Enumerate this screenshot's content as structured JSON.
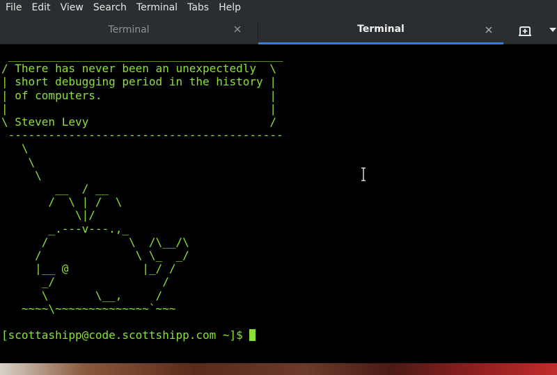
{
  "menu": {
    "items": [
      "File",
      "Edit",
      "View",
      "Search",
      "Terminal",
      "Tabs",
      "Help"
    ]
  },
  "tabs": [
    {
      "label": "Terminal",
      "active": false
    },
    {
      "label": "Terminal",
      "active": true
    }
  ],
  "icons": {
    "tab_close": "close-icon",
    "new_tab": "new-tab-icon",
    "tabs_menu": "chevron-down-icon",
    "text_cursor": "ibeam-cursor-icon"
  },
  "colors": {
    "terminal_text": "#8ae234",
    "active_tab_indicator": "#2f7fd7",
    "chrome_background": "#2b2e30"
  },
  "terminal": {
    "output": " _________________________________________\n/ There has never been an unexpectedly  \\\n| short debugging period in the history |\n| of computers.                         |\n|                                       |\n\\ Steven Levy                           /\n -----------------------------------------\n   \\\n    \\\n     \\\n        __  / __\n       /  \\ | /  \\\n           \\|/\n       _.---v---.,_\n      /            \\  /\\__/\\\n     /              \\ \\_  _/\n     |__ @           |_/ /\n      _/                /\n      \\       \\__,     /\n   ~~~~\\~~~~~~~~~~~~~~`~~~\n\n",
    "prompt": "[scottashipp@code.scottshipp.com ~]$ "
  }
}
